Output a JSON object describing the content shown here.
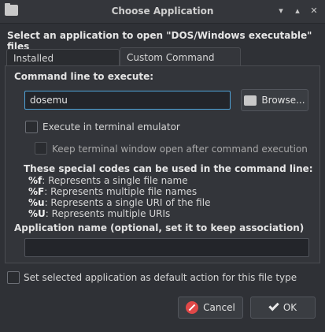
{
  "window": {
    "title": "Choose Application",
    "buttons": {
      "shade": "▾",
      "maximize": "▴",
      "close": "✕"
    }
  },
  "prompt": "Select an application to open \"DOS/Windows executable\" files",
  "tabs": [
    {
      "label": "Installed Applications",
      "active": false
    },
    {
      "label": "Custom Command Line",
      "active": true
    }
  ],
  "custom": {
    "command_label": "Command line to execute:",
    "command_value": "dosemu",
    "browse_label": "Browse...",
    "terminal_label": "Execute in terminal emulator",
    "terminal_checked": false,
    "keep_open_label": "Keep terminal window open after command execution",
    "keep_open_checked": false,
    "codes_heading": "These special codes can be used in the command line:",
    "codes": [
      {
        "code": "%f",
        "desc": ": Represents a single file name"
      },
      {
        "code": "%F",
        "desc": ": Represents multiple file names"
      },
      {
        "code": "%u",
        "desc": ": Represents a single URI of the file"
      },
      {
        "code": "%U",
        "desc": ": Represents multiple URIs"
      }
    ],
    "appname_label": "Application name (optional, set it to keep association)",
    "appname_value": ""
  },
  "default_action_label": "Set selected application as default action for this file type",
  "default_action_checked": false,
  "footer": {
    "cancel_label": "Cancel",
    "ok_label": "OK"
  },
  "colors": {
    "background": "#2f3136",
    "focus_accent": "#4fa3d8",
    "cancel_icon": "#e04848"
  },
  "icons": {
    "app": "folder-icon",
    "browse": "folder-open-icon",
    "cancel": "cancel-icon",
    "ok": "checkmark-icon"
  }
}
